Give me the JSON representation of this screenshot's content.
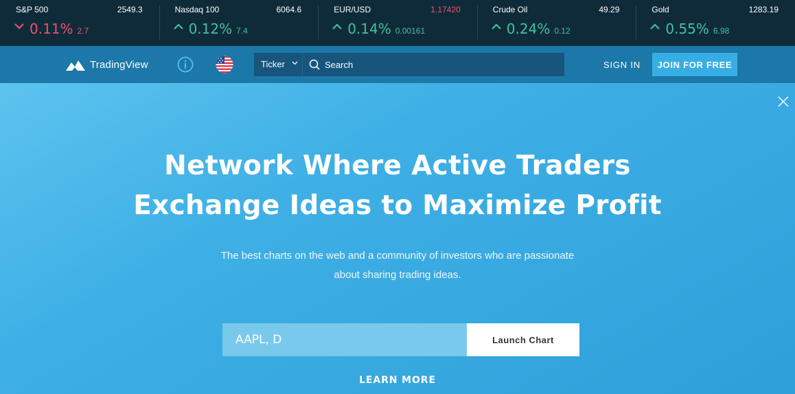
{
  "ticker": [
    {
      "name": "S&P 500",
      "price": "2549.3",
      "pct": "0.11%",
      "abs": "2.7",
      "direction": "down",
      "price_color": "#ffffff"
    },
    {
      "name": "Nasdaq 100",
      "price": "6064.6",
      "pct": "0.12%",
      "abs": "7.4",
      "direction": "up",
      "price_color": "#ffffff"
    },
    {
      "name": "EUR/USD",
      "price": "1.17420",
      "pct": "0.14%",
      "abs": "0.00161",
      "direction": "up",
      "price_color": "#f1506b"
    },
    {
      "name": "Crude Oil",
      "price": "49.29",
      "pct": "0.24%",
      "abs": "0.12",
      "direction": "up",
      "price_color": "#ffffff"
    },
    {
      "name": "Gold",
      "price": "1283.19",
      "pct": "0.55%",
      "abs": "6.98",
      "direction": "up",
      "price_color": "#ffffff"
    }
  ],
  "header": {
    "logo_text": "TradingView",
    "ticker_select": "Ticker",
    "search_placeholder": "Search",
    "sign_in": "SIGN IN",
    "join": "JOIN FOR FREE"
  },
  "hero": {
    "title_line1": "Network Where Active Traders",
    "title_line2": "Exchange Ideas to Maximize Profit",
    "subtitle_line1": "The best charts on the web and a community of investors who are passionate",
    "subtitle_line2": "about sharing trading ideas.",
    "launch_placeholder": "AAPL, D",
    "launch_button": "Launch Chart",
    "learn_more": "LEARN MORE"
  },
  "colors": {
    "up": "#42c29e",
    "down": "#f1506b",
    "ticker_bg": "#0f2b3a",
    "header_bg": "#1c78a8",
    "accent": "#37aee3"
  }
}
